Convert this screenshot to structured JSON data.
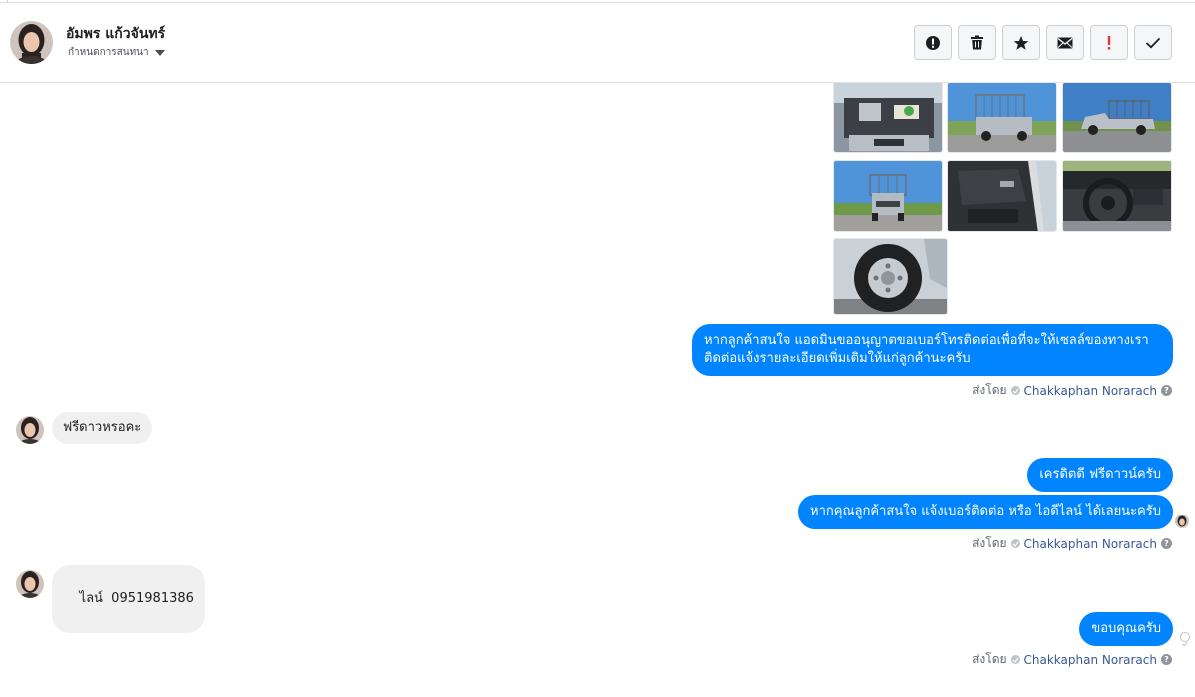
{
  "header": {
    "contact_name": "อัมพร แก้วจันทร์",
    "conversation_label": "กำหนดการสนทนา",
    "actions": [
      {
        "name": "spam-button",
        "icon": "alert-circle-icon"
      },
      {
        "name": "delete-button",
        "icon": "trash-icon"
      },
      {
        "name": "star-button",
        "icon": "star-icon"
      },
      {
        "name": "mark-unread-button",
        "icon": "envelope-icon"
      },
      {
        "name": "mark-important-button",
        "icon": "exclamation-icon"
      },
      {
        "name": "mark-done-button",
        "icon": "check-icon"
      }
    ]
  },
  "thread": {
    "photos": [
      {
        "name": "photo-engine-bay",
        "icon": "photo-icon"
      },
      {
        "name": "photo-truck-rear-rack",
        "icon": "photo-icon"
      },
      {
        "name": "photo-truck-side",
        "icon": "photo-icon"
      },
      {
        "name": "photo-truck-rear",
        "icon": "photo-icon"
      },
      {
        "name": "photo-door-interior",
        "icon": "photo-icon"
      },
      {
        "name": "photo-steering-wheel",
        "icon": "photo-icon"
      },
      {
        "name": "photo-wheel",
        "icon": "photo-icon"
      }
    ],
    "messages": {
      "out_1": "หากลูกค้าสนใจ แอดมินขออนุญาตขอเบอร์โทรติดต่อเพื่อที่จะให้เซลล์ของทางเราติดต่อแจ้งรายละเอียดเพิ่มเติมให้แก่ลูกค้านะครับ",
      "in_1": "ฟรีดาวหรอคะ",
      "out_2": "เครดิตดี ฟรีดาวน์ครับ",
      "out_3": "หากคุณลูกค้าสนใจ แจ้งเบอร์ติดต่อ หรือ ไอดีไลน์ ได้เลยนะครับ",
      "in_2": "ไลน์  0951981386",
      "out_4": "ขอบคุณครับ"
    },
    "sent_by_label": "ส่งโดย",
    "agent_name": "Chakkaphan Norarach",
    "help_glyph": "?"
  },
  "colors": {
    "accent_blue": "#0084ff",
    "incoming_gray": "#f1f0f0",
    "link_blue": "#385898",
    "important_red": "#e0393e"
  }
}
